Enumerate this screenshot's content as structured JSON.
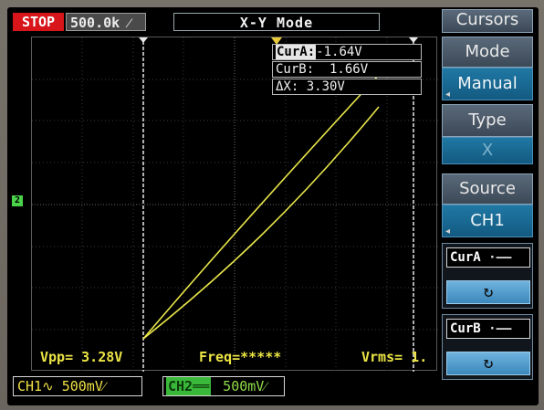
{
  "top": {
    "run_state": "STOP",
    "timebase": "500.0k ⁄",
    "mode": "X-Y    Mode"
  },
  "cursor_readout": {
    "cur_a_tag": "CurA:",
    "cur_a_value": "-1.64V",
    "cur_b": "CurB:  1.66V",
    "delta": "ΔX: 3.30V"
  },
  "measurements": {
    "vpp": "Vpp= 3.28V",
    "freq": "Freq=*****",
    "vrms": "Vrms= 1."
  },
  "channels": {
    "ch1": "CH1∿  500mV⁄",
    "ch2_tag": "CH2══",
    "ch2": " 500mV⁄",
    "ch2_marker": "2"
  },
  "menu": {
    "title": "Cursors",
    "mode_label": "Mode",
    "mode_value": "Manual",
    "type_label": "Type",
    "type_value": "X",
    "source_label": "Source",
    "source_value": "CH1",
    "cur_a": "CurA",
    "cur_b": "CurB",
    "knob_glyph": "↻"
  },
  "colors": {
    "trace": "#e8e64a",
    "stop": "#d7151a",
    "ch2": "#39b83a",
    "menu_blue": "#1f78a3"
  },
  "icons": [
    "wave-ac-icon",
    "knob-rotate-icon",
    "trigger-marker-icon"
  ]
}
